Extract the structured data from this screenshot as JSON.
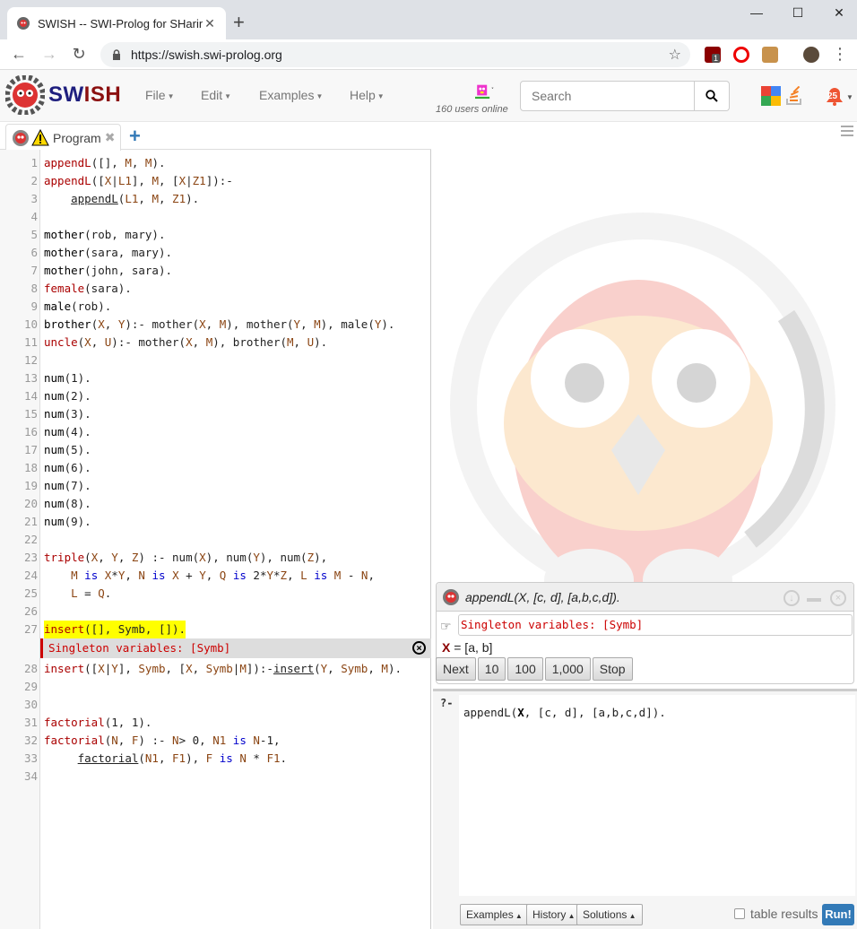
{
  "browser": {
    "tab_title": "SWISH -- SWI-Prolog for SHaring",
    "new_tab_symbol": "+",
    "url": "https://swish.swi-prolog.org",
    "extension_badge": "1"
  },
  "navbar": {
    "brand": {
      "sw": "SW",
      "ish": "ISH"
    },
    "menus": [
      "File",
      "Edit",
      "Examples",
      "Help"
    ],
    "users_online": "160 users online",
    "search_placeholder": "Search",
    "notification_count": "25"
  },
  "editor": {
    "tab_label": "Program",
    "error_widget": "Singleton variables: [Symb]",
    "line_numbers": [
      "1",
      "2",
      "3",
      "4",
      "5",
      "6",
      "7",
      "8",
      "9",
      "10",
      "11",
      "12",
      "13",
      "14",
      "15",
      "16",
      "17",
      "18",
      "19",
      "20",
      "21",
      "22",
      "23",
      "24",
      "25",
      "26",
      "27",
      "28",
      "29",
      "30",
      "31",
      "32",
      "33",
      "34"
    ],
    "lines": [
      "appendL([], M, M).",
      "appendL([X|L1], M, [X|Z1]):-",
      "    appendL(L1, M, Z1).",
      "",
      "mother(rob, mary).",
      "mother(sara, mary).",
      "mother(john, sara).",
      "female(sara).",
      "male(rob).",
      "brother(X, Y):- mother(X, M), mother(Y, M), male(Y).",
      "uncle(X, U):- mother(X, M), brother(M, U).",
      "",
      "num(1).",
      "num(2).",
      "num(3).",
      "num(4).",
      "num(5).",
      "num(6).",
      "num(7).",
      "num(8).",
      "num(9).",
      "",
      "triple(X, Y, Z) :- num(X), num(Y), num(Z),",
      "    M is X*Y, N is X + Y, Q is 2*Y*Z, L is M - N,",
      "    L = Q.",
      "",
      "insert([], Symb, []).",
      "insert([X|Y], Symb, [X, Symb|M]):-insert(Y, Symb, M).",
      "",
      "",
      "factorial(1, 1).",
      "factorial(N, F) :- N> 0, N1 is N-1,",
      "     factorial(N1, F1), F is N * F1.",
      ""
    ]
  },
  "answer": {
    "query": "appendL(X, [c, d], [a,b,c,d]).",
    "warning": "Singleton variables: [Symb]",
    "binding_var": "X",
    "binding_value": "= [a, b]",
    "buttons": [
      "Next",
      "10",
      "100",
      "1,000",
      "Stop"
    ]
  },
  "query_pane": {
    "prompt": "?-",
    "query_pre": "appendL(",
    "query_var": "X",
    "query_post": ", [c, d], [a,b,c,d]).",
    "examples_label": "Examples",
    "history_label": "History",
    "solutions_label": "Solutions",
    "table_results_label": "table results",
    "run_label": "Run!"
  }
}
